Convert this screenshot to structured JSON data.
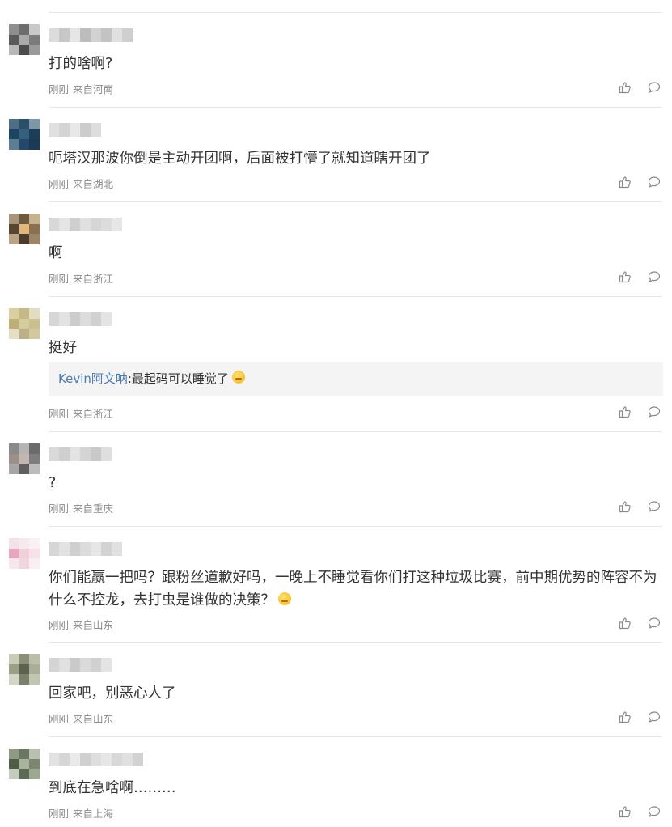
{
  "comments": [
    {
      "text": "打的啥啊?",
      "time": "刚刚",
      "location": "来自河南",
      "avatar_colors": [
        "#8e8e8e",
        "#6d6d6d",
        "#c9c9c9",
        "#5a5a5a",
        "#aaaaaa",
        "#7b7b7b",
        "#b8b8b8",
        "#4c4c4c",
        "#9a9a9a"
      ],
      "name_colors": [
        "#dcdcdc",
        "#c7c7c7",
        "#e6e6e6",
        "#bdbdbd",
        "#d2d2d2",
        "#c3c3c3",
        "#e0e0e0",
        "#cfcfcf"
      ]
    },
    {
      "text": "呃塔汉那波你倒是主动开团啊，后面被打懵了就知道瞎开团了",
      "time": "刚刚",
      "location": "来自湖北",
      "avatar_colors": [
        "#4d6f86",
        "#294f6b",
        "#7c97a8",
        "#1d4463",
        "#36607f",
        "#1c3e5b",
        "#5d7d92",
        "#23486a",
        "#1b3a56"
      ],
      "name_colors": [
        "#e0e0e0",
        "#d4d4d4",
        "#e8e8e8",
        "#cccccc",
        "#dddddd"
      ]
    },
    {
      "text": "啊",
      "time": "刚刚",
      "location": "来自浙江",
      "avatar_colors": [
        "#a8957a",
        "#6e5a40",
        "#c9b28e",
        "#5a4630",
        "#e0b87a",
        "#8a7050",
        "#b9a486",
        "#4a3b2a",
        "#9c8566"
      ],
      "name_colors": [
        "#d8d8d8",
        "#e4e4e4",
        "#cfcfcf",
        "#e0e0e0",
        "#d6d6d6",
        "#dcdcdc",
        "#e6e6e6"
      ]
    },
    {
      "text": "挺好",
      "time": "刚刚",
      "location": "来自浙江",
      "reply": {
        "name": "Kevin阿文呐",
        "text": ":最起码可以睡觉了"
      },
      "avatar_colors": [
        "#d9cfa0",
        "#c8b984",
        "#e2dcc0",
        "#bfae78",
        "#d6cd9c",
        "#cbbf92",
        "#e6dfc4",
        "#bdb088",
        "#d2c79e"
      ],
      "name_colors": [
        "#d6d6d6",
        "#e2e2e2",
        "#cccccc",
        "#dcdcdc",
        "#d0d0d0",
        "#e4e4e4"
      ]
    },
    {
      "text": "?",
      "time": "刚刚",
      "location": "来自重庆",
      "avatar_colors": [
        "#8a8a8a",
        "#b5b5b5",
        "#6b6b6b",
        "#9c8f8a",
        "#c4b6ae",
        "#7d7d7d",
        "#a6a6a6",
        "#5f5f5f",
        "#bcbcbc"
      ],
      "name_colors": [
        "#d9d9d9",
        "#cfcfcf",
        "#e3e3e3",
        "#d4d4d4",
        "#c9c9c9",
        "#dedede"
      ]
    },
    {
      "text": "你们能赢一把吗？跟粉丝道歉好吗，一晚上不睡觉看你们打这种垃圾比赛，前中期优势的阵容不为什么不控龙，去打虫是谁做的决策？",
      "time": "刚刚",
      "location": "来自山东",
      "avatar_colors": [
        "#f3e3e8",
        "#f7eaee",
        "#fbf1f4",
        "#e8a7be",
        "#f1d0da",
        "#f6e2e8",
        "#f6e8ec",
        "#f0d6de",
        "#faeef2"
      ],
      "name_colors": [
        "#d6d6d6",
        "#e2e2e2",
        "#cfcfcf",
        "#dcdcdc",
        "#e6e6e6",
        "#d2d2d2",
        "#e0e0e0"
      ]
    },
    {
      "text": "回家吧，别恶心人了",
      "time": "刚刚",
      "location": "来自山东",
      "avatar_colors": [
        "#c7cdb9",
        "#8a8f78",
        "#b9bfa8",
        "#9aa086",
        "#5d6150",
        "#a9ae96",
        "#d2d6c6",
        "#7b806a",
        "#c0c6b0"
      ],
      "name_colors": [
        "#d4d4d4",
        "#e0e0e0",
        "#cacaca",
        "#dadada",
        "#d0d0d0",
        "#e4e4e4"
      ]
    },
    {
      "text": "到底在急啥啊………",
      "time": "刚刚",
      "location": "来自上海",
      "avatar_colors": [
        "#8f9a86",
        "#6a7660",
        "#b9c0b0",
        "#4f5e47",
        "#a9b39e",
        "#7a8670",
        "#c6ccbd",
        "#5c6a53",
        "#9da892"
      ],
      "name_colors": [
        "#e2e2e2",
        "#d6d6d6",
        "#eaeaea",
        "#d0d0d0",
        "#dedede",
        "#e6e6e6",
        "#d8d8d8",
        "#e0e0e0",
        "#d2d2d2"
      ]
    }
  ]
}
